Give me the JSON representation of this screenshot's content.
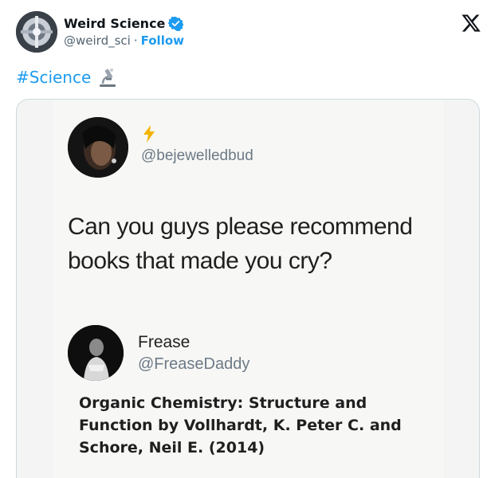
{
  "author": {
    "display_name": "Weird Science",
    "handle": "@weird_sci",
    "separator": "·",
    "follow_label": "Follow",
    "verified": true
  },
  "tweet": {
    "hashtag": "#Science",
    "emoji_icon": "microscope-icon"
  },
  "embedded_screenshot": {
    "question_author_handle": "@bejewelledbud",
    "question_text": "Can you guys please recommend books that made you cry?",
    "reply_author_name": "Frease",
    "reply_author_handle": "@FreaseDaddy",
    "reply_text": "Organic Chemistry: Structure and Function by Vollhardt, K. Peter C. and Schore, Neil E. (2014)"
  },
  "colors": {
    "accent": "#1d9bf0",
    "secondary_text": "#536471",
    "border": "#cfd9de"
  }
}
